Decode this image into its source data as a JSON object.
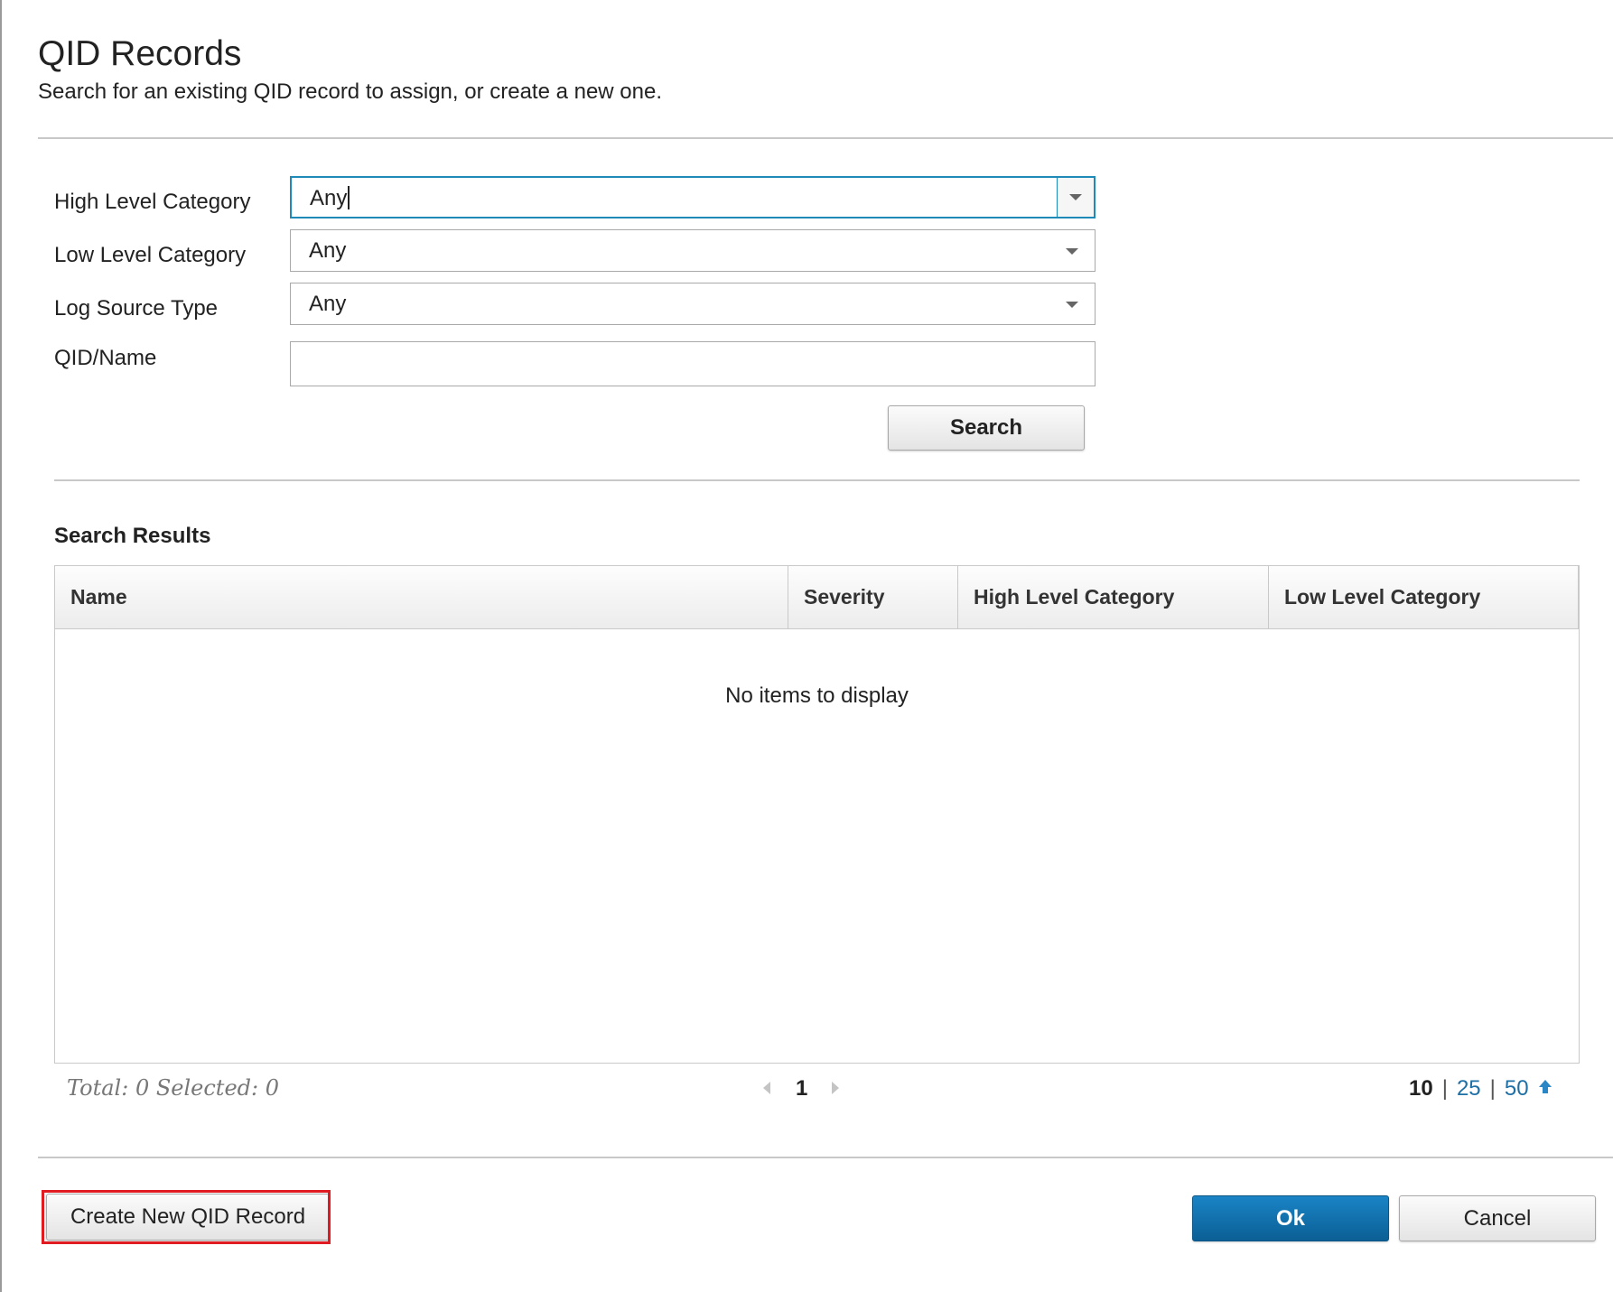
{
  "dialog": {
    "title": "QID Records",
    "subtitle": "Search for an existing QID record to assign, or create a new one."
  },
  "form": {
    "high_level_category": {
      "label": "High Level Category",
      "value": "Any"
    },
    "low_level_category": {
      "label": "Low Level Category",
      "value": "Any"
    },
    "log_source_type": {
      "label": "Log Source Type",
      "value": "Any"
    },
    "qid_name": {
      "label": "QID/Name",
      "value": ""
    },
    "search_button": "Search"
  },
  "results": {
    "heading": "Search Results",
    "columns": [
      "Name",
      "Severity",
      "High Level Category",
      "Low Level Category"
    ],
    "rows": [],
    "empty_message": "No items to display"
  },
  "footer": {
    "total_text": "Total: 0 Selected: 0",
    "current_page": "1",
    "page_sizes": [
      "10",
      "25",
      "50"
    ],
    "selected_page_size": "10"
  },
  "actions": {
    "create_button": "Create New QID Record",
    "ok_button": "Ok",
    "cancel_button": "Cancel"
  },
  "icons": {
    "dropdown": "chevron-down-icon",
    "prev": "chevron-left-icon",
    "next": "chevron-right-icon",
    "sort": "arrow-up-icon"
  },
  "colors": {
    "primary_button": "#0b6aa8",
    "link": "#1d6fa5",
    "focus_border": "#1f8ab8",
    "highlight": "#e01b22"
  }
}
